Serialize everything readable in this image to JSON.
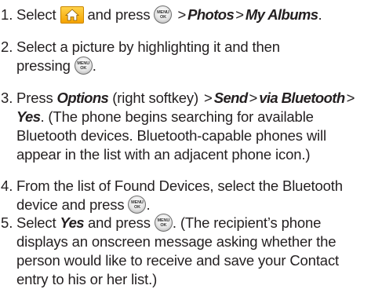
{
  "steps": [
    {
      "number": "1.",
      "pre": "Select",
      "mid": "and press",
      "path_1": "Photos",
      "path_2": "My Albums",
      "end": "."
    },
    {
      "number": "2.",
      "line_1": "Select a picture by highlighting it and then",
      "line_2_pre": "pressing",
      "end": "."
    },
    {
      "number": "3.",
      "pre": "Press",
      "options": "Options",
      "options_note": "(right softkey)",
      "send": "Send",
      "via_bluetooth": "via Bluetooth",
      "yes": "Yes",
      "line_1_tail": ". (The phone begins searching for available",
      "line_2": "Bluetooth devices. Bluetooth-capable phones will",
      "line_3": "appear in the list with an adjacent phone icon.)"
    },
    {
      "number": "4.",
      "line_1": "From the list of Found Devices, select the Bluetooth",
      "line_2_pre": "device and press",
      "end": "."
    },
    {
      "number": "5.",
      "pre": "Select",
      "yes": "Yes",
      "mid": "and press",
      "line_1_tail": ". (The recipient’s phone",
      "line_2": "displays an onscreen message asking whether the",
      "line_3": "person would like to receive and save your Contact",
      "line_4": "entry to his or her list.)"
    }
  ],
  "separator": ">",
  "menu_key": {
    "top": "MENU",
    "bottom": "OK"
  },
  "icons": {
    "home_key": "home-key-icon",
    "menu_ok_key": "menu-ok-key-icon",
    "home_key_color": "#f5a300"
  }
}
